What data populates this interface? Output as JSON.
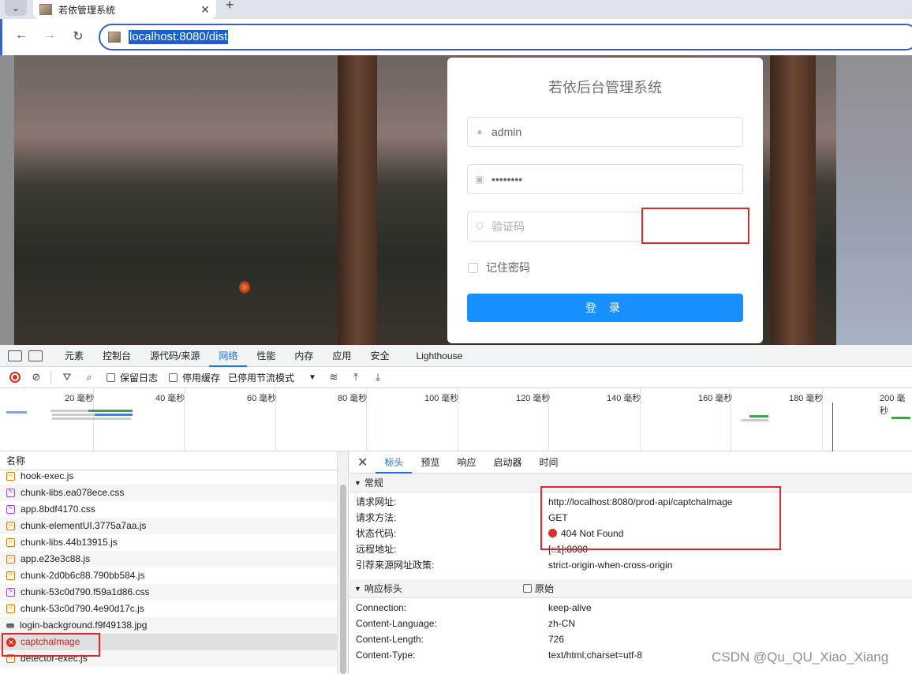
{
  "browser": {
    "tab_title": "若依管理系统",
    "url": "localhost:8080/dist"
  },
  "login": {
    "title": "若依后台管理系统",
    "username": "admin",
    "password_mask": "••••••••",
    "captcha_placeholder": "验证码",
    "remember_label": "记住密码",
    "login_button": "登 录"
  },
  "devtools": {
    "tabs": [
      "元素",
      "控制台",
      "源代码/来源",
      "网络",
      "性能",
      "内存",
      "应用",
      "安全",
      "Lighthouse"
    ],
    "active_tab": "网络",
    "toolbar": {
      "preserve_log": "保留日志",
      "disable_cache": "停用缓存",
      "throttling": "已停用节流模式"
    },
    "timeline_labels": [
      "20 毫秒",
      "40 毫秒",
      "60 毫秒",
      "80 毫秒",
      "100 毫秒",
      "120 毫秒",
      "140 毫秒",
      "160 毫秒",
      "180 毫秒",
      "200 毫秒"
    ],
    "list_header": "名称",
    "requests": [
      {
        "name": "hook-exec.js",
        "type": "js"
      },
      {
        "name": "chunk-libs.ea078ece.css",
        "type": "css"
      },
      {
        "name": "app.8bdf4170.css",
        "type": "css"
      },
      {
        "name": "chunk-elementUI.3775a7aa.js",
        "type": "js"
      },
      {
        "name": "chunk-libs.44b13915.js",
        "type": "js"
      },
      {
        "name": "app.e23e3c88.js",
        "type": "js"
      },
      {
        "name": "chunk-2d0b6c88.790bb584.js",
        "type": "js"
      },
      {
        "name": "chunk-53c0d790.f59a1d86.css",
        "type": "css"
      },
      {
        "name": "chunk-53c0d790.4e90d17c.js",
        "type": "js"
      },
      {
        "name": "login-background.f9f49138.jpg",
        "type": "img"
      },
      {
        "name": "captchaImage",
        "type": "error"
      },
      {
        "name": "detector-exec.js",
        "type": "js"
      }
    ],
    "detail_tabs": [
      "标头",
      "预览",
      "响应",
      "启动器",
      "时间"
    ],
    "general": {
      "title": "常规",
      "rows": [
        {
          "k": "请求网址:",
          "v": "http://localhost:8080/prod-api/captchaImage"
        },
        {
          "k": "请求方法:",
          "v": "GET"
        },
        {
          "k": "状态代码:",
          "v": "404 Not Found"
        },
        {
          "k": "远程地址:",
          "v": "[::1]:8080"
        },
        {
          "k": "引荐来源网址政策:",
          "v": "strict-origin-when-cross-origin"
        }
      ]
    },
    "response_headers": {
      "title": "响应标头",
      "raw_label": "原始",
      "rows": [
        {
          "k": "Connection:",
          "v": "keep-alive"
        },
        {
          "k": "Content-Language:",
          "v": "zh-CN"
        },
        {
          "k": "Content-Length:",
          "v": "726"
        },
        {
          "k": "Content-Type:",
          "v": "text/html;charset=utf-8"
        }
      ]
    }
  },
  "watermark": "CSDN @Qu_QU_Xiao_Xiang",
  "colors": {
    "accent": "#1a73e8",
    "login_button": "#1890ff",
    "error": "#d93025",
    "highlight_box": "#e0282e"
  }
}
